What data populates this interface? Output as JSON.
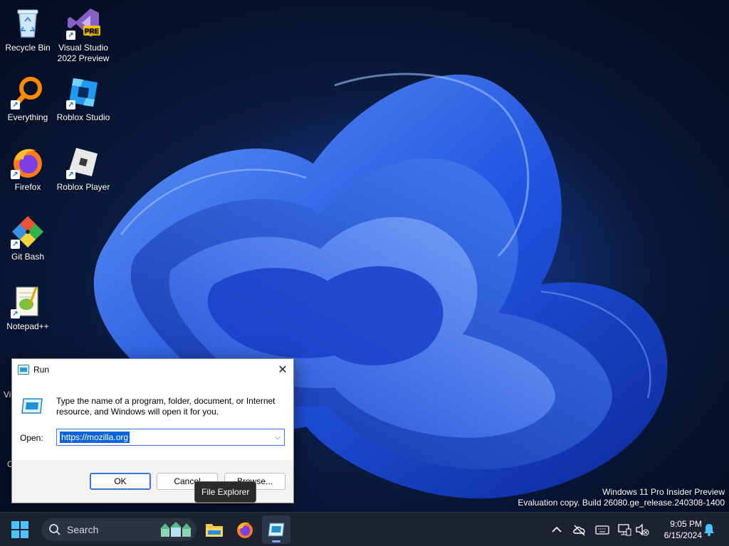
{
  "desktop": {
    "icons": [
      {
        "label": "Recycle Bin",
        "icon": "recycle-bin-icon"
      },
      {
        "label": "Visual Studio 2022 Preview",
        "icon": "visual-studio-icon",
        "badge": "PRE"
      },
      {
        "label": "Everything",
        "icon": "everything-icon"
      },
      {
        "label": "Roblox Studio",
        "icon": "roblox-studio-icon"
      },
      {
        "label": "Firefox",
        "icon": "firefox-icon"
      },
      {
        "label": "Roblox Player",
        "icon": "roblox-player-icon"
      },
      {
        "label": "Git Bash",
        "icon": "git-bash-icon"
      },
      {
        "label": "Notepad++",
        "icon": "notepad-plus-plus-icon"
      }
    ],
    "partial_labels": [
      "Vi",
      "C"
    ],
    "watermark": {
      "line1": "Windows 11 Pro Insider Preview",
      "line2": "Evaluation copy. Build 26080.ge_release.240308-1400"
    }
  },
  "run_dialog": {
    "title": "Run",
    "description": "Type the name of a program, folder, document, or Internet resource, and Windows will open it for you.",
    "open_label": "Open:",
    "open_value": "https://mozilla.org",
    "ok_label": "OK",
    "cancel_label": "Cancel",
    "browse_label": "Browse..."
  },
  "tooltip": {
    "text": "File Explorer"
  },
  "taskbar": {
    "search_placeholder": "Search",
    "apps": [
      "file-explorer-icon",
      "firefox-icon",
      "run-icon"
    ],
    "clock_time": "9:05 PM",
    "clock_date": "6/15/2024"
  },
  "colors": {
    "accent": "#0a64d8",
    "taskbar_bg": "#1c2230",
    "wallpaper_blue": "#2a5cf0"
  }
}
